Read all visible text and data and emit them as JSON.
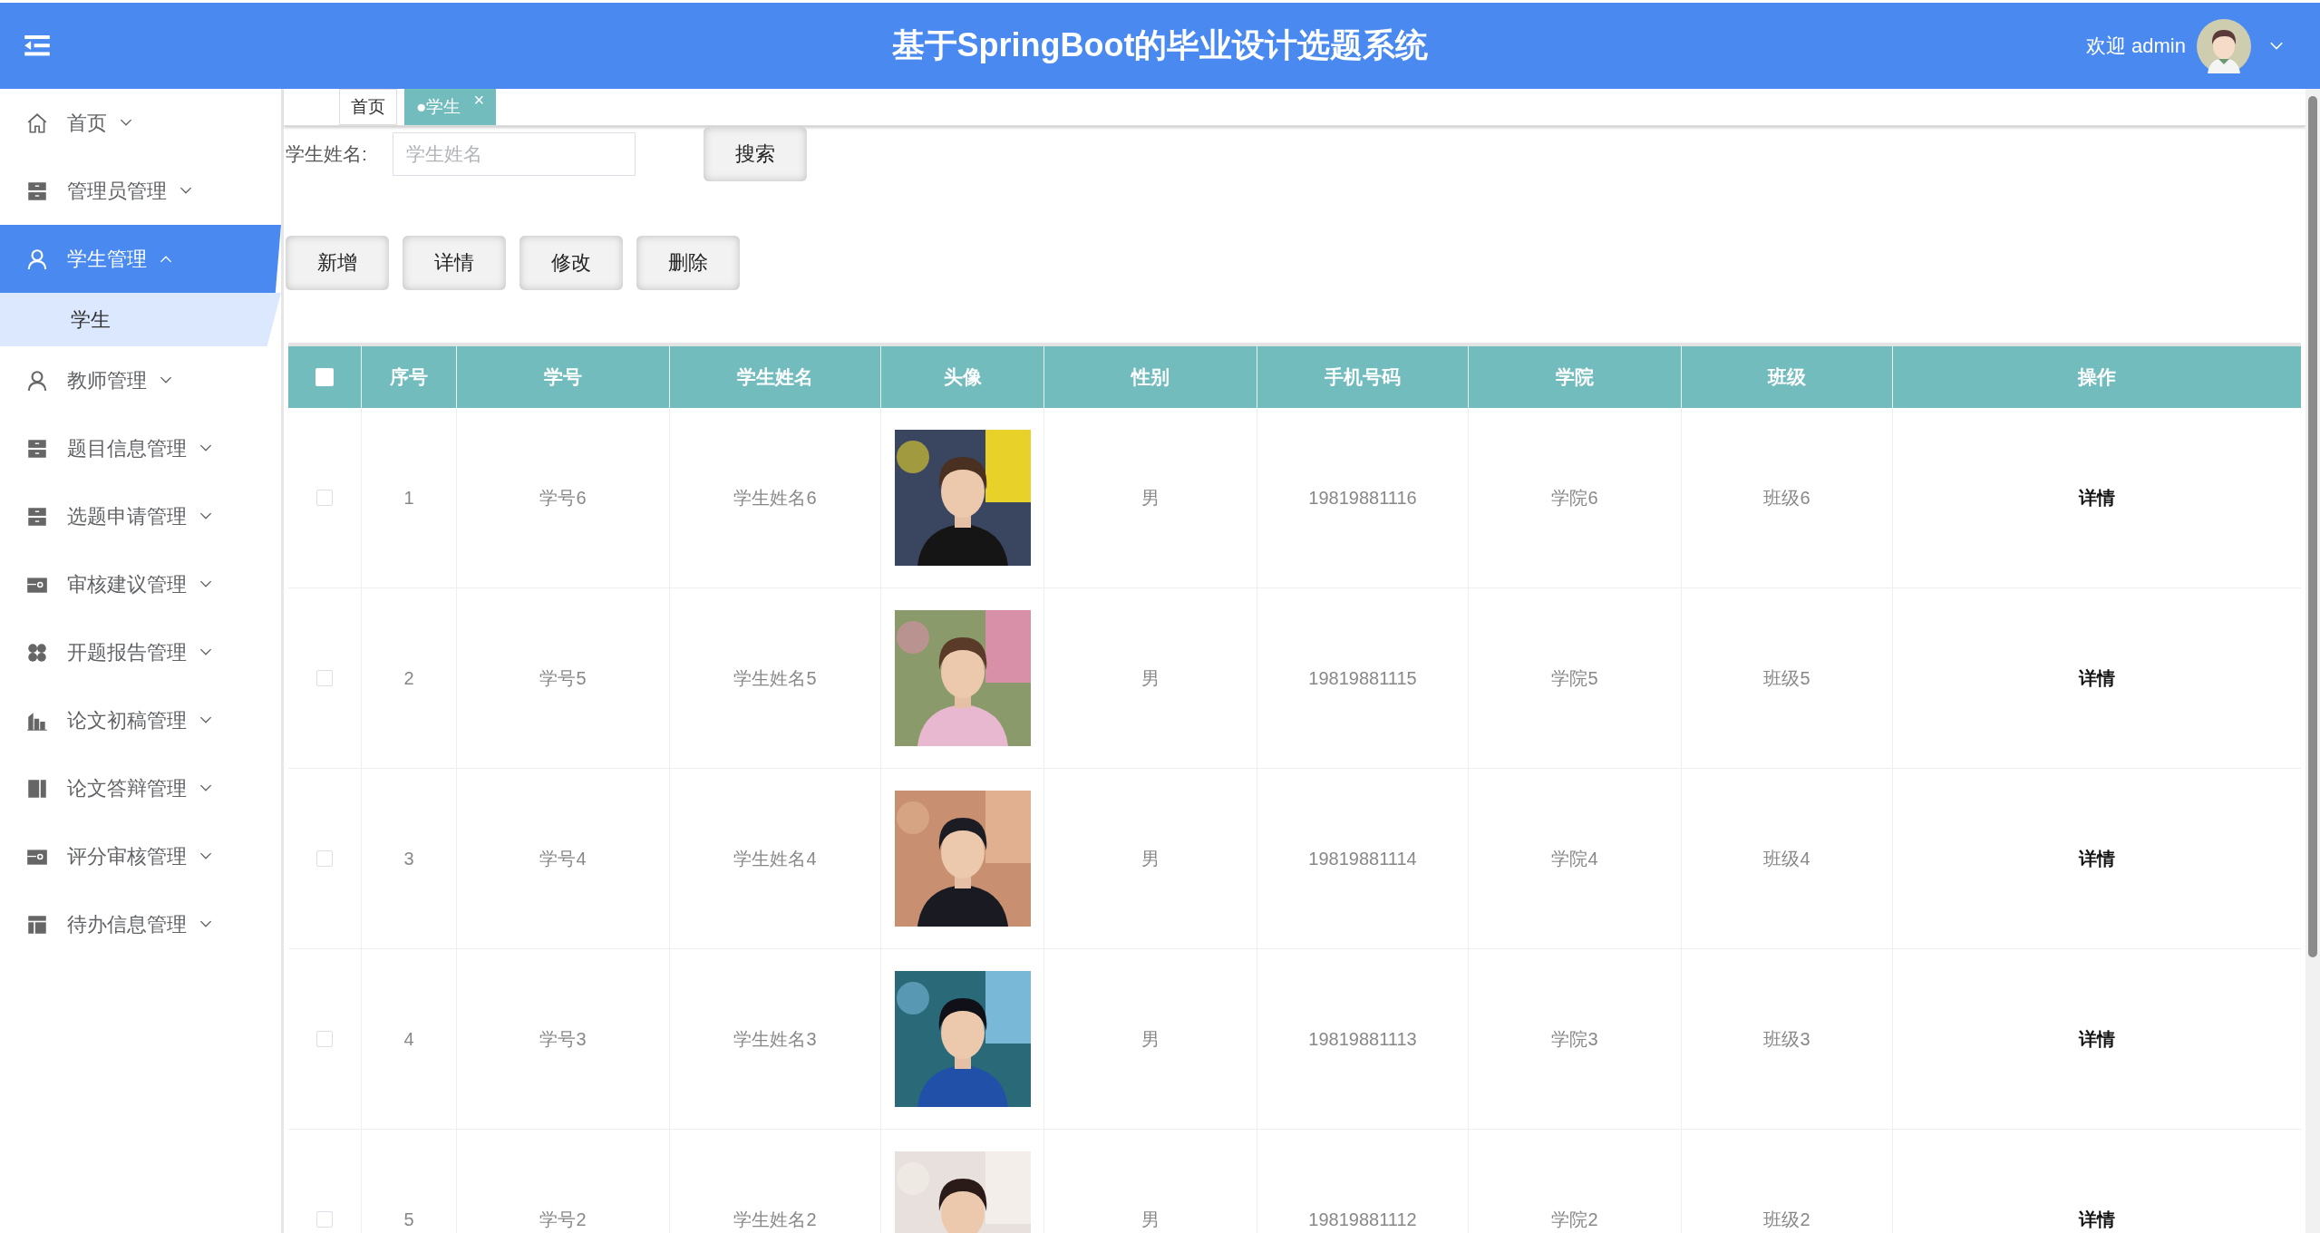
{
  "header": {
    "title": "基于SpringBoot的毕业设计选题系统",
    "welcome": "欢迎 admin"
  },
  "sidebar": {
    "items": [
      {
        "label": "首页",
        "selected": false,
        "expanded": false
      },
      {
        "label": "管理员管理",
        "selected": false,
        "expanded": false
      },
      {
        "label": "学生管理",
        "selected": true,
        "expanded": true,
        "children": [
          {
            "label": "学生",
            "selected": true
          }
        ]
      },
      {
        "label": "教师管理",
        "selected": false,
        "expanded": false
      },
      {
        "label": "题目信息管理",
        "selected": false,
        "expanded": false
      },
      {
        "label": "选题申请管理",
        "selected": false,
        "expanded": false
      },
      {
        "label": "审核建议管理",
        "selected": false,
        "expanded": false
      },
      {
        "label": "开题报告管理",
        "selected": false,
        "expanded": false
      },
      {
        "label": "论文初稿管理",
        "selected": false,
        "expanded": false
      },
      {
        "label": "论文答辩管理",
        "selected": false,
        "expanded": false
      },
      {
        "label": "评分审核管理",
        "selected": false,
        "expanded": false
      },
      {
        "label": "待办信息管理",
        "selected": false,
        "expanded": false
      }
    ]
  },
  "tabs": [
    {
      "label": "首页",
      "selected": false
    },
    {
      "label": "●学生",
      "selected": true,
      "close": "×"
    }
  ],
  "search": {
    "label": "学生姓名:",
    "placeholder": "学生姓名",
    "button": "搜索"
  },
  "actions": [
    "新增",
    "详情",
    "修改",
    "删除"
  ],
  "table": {
    "columns": [
      "序号",
      "学号",
      "学生姓名",
      "头像",
      "性别",
      "手机号码",
      "学院",
      "班级",
      "操作"
    ],
    "select_all_checked": false,
    "rows": [
      {
        "checked": false,
        "cells": [
          "1",
          "学号6",
          "学生姓名6",
          {
            "kind": "picture"
          },
          "男",
          "19819881116",
          "学院6",
          "班级6",
          "详情"
        ]
      },
      {
        "checked": false,
        "cells": [
          "2",
          "学号5",
          "学生姓名5",
          {
            "kind": "picture"
          },
          "男",
          "19819881115",
          "学院5",
          "班级5",
          "详情"
        ]
      },
      {
        "checked": false,
        "cells": [
          "3",
          "学号4",
          "学生姓名4",
          {
            "kind": "picture"
          },
          "男",
          "19819881114",
          "学院4",
          "班级4",
          "详情"
        ]
      },
      {
        "checked": false,
        "cells": [
          "4",
          "学号3",
          "学生姓名3",
          {
            "kind": "picture"
          },
          "男",
          "19819881113",
          "学院3",
          "班级3",
          "详情"
        ]
      },
      {
        "checked": false,
        "cells": [
          "5",
          "学号2",
          "学生姓名2",
          {
            "kind": "picture"
          },
          "男",
          "19819881112",
          "学院2",
          "班级2",
          "详情"
        ]
      }
    ]
  }
}
